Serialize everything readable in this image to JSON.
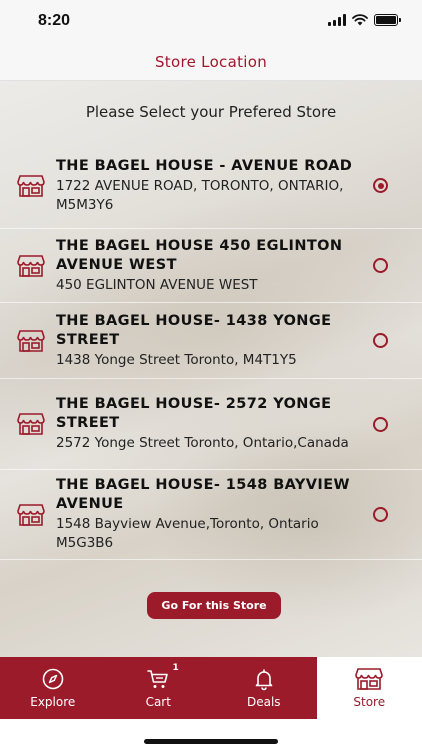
{
  "status_bar": {
    "time": "8:20"
  },
  "header": {
    "title": "Store Location"
  },
  "prompt": "Please Select your Prefered Store",
  "stores": [
    {
      "name": "THE BAGEL HOUSE - AVENUE ROAD",
      "address": "1722 AVENUE ROAD, TORONTO, ONTARIO, M5M3Y6",
      "selected": true
    },
    {
      "name": "THE BAGEL HOUSE 450 EGLINTON AVENUE WEST",
      "address": "450 EGLINTON AVENUE WEST",
      "selected": false
    },
    {
      "name": "THE BAGEL HOUSE- 1438 YONGE STREET",
      "address": "1438 Yonge Street Toronto, M4T1Y5",
      "selected": false
    },
    {
      "name": "THE BAGEL HOUSE- 2572 YONGE STREET",
      "address": "2572 Yonge Street Toronto, Ontario,Canada",
      "selected": false
    },
    {
      "name": "THE BAGEL HOUSE- 1548 BAYVIEW AVENUE",
      "address": "1548 Bayview Avenue,Toronto, Ontario M5G3B6",
      "selected": false
    }
  ],
  "action_button": {
    "label": "Go For this Store"
  },
  "tab_bar": {
    "tabs": [
      {
        "label": "Explore",
        "icon": "compass-icon",
        "active": false
      },
      {
        "label": "Cart",
        "icon": "cart-icon",
        "active": false,
        "badge": "1"
      },
      {
        "label": "Deals",
        "icon": "bell-icon",
        "active": false
      },
      {
        "label": "Store",
        "icon": "store-icon",
        "active": true
      }
    ]
  },
  "colors": {
    "accent": "#9b1b2a",
    "title": "#a3162b"
  }
}
